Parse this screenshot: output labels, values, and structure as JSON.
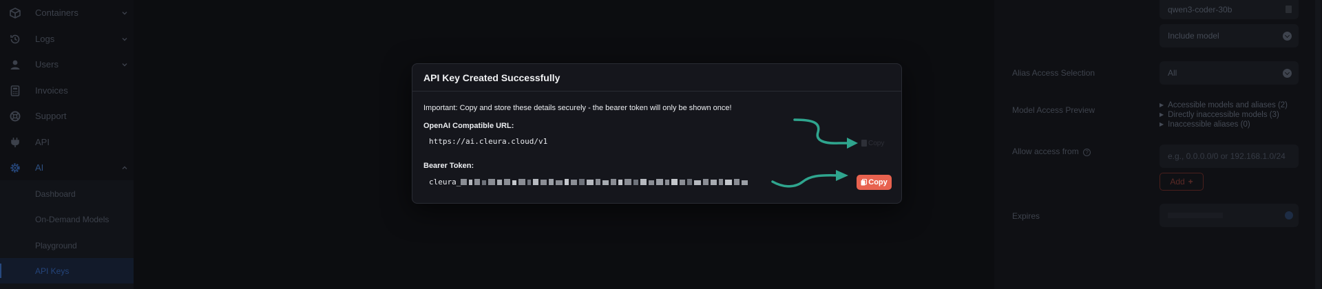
{
  "sidebar": {
    "items": [
      {
        "label": "Containers",
        "icon": "box-icon"
      },
      {
        "label": "Logs",
        "icon": "history-icon"
      },
      {
        "label": "Users",
        "icon": "user-icon"
      },
      {
        "label": "Invoices",
        "icon": "calculator-icon"
      },
      {
        "label": "Support",
        "icon": "lifebuoy-icon"
      },
      {
        "label": "API",
        "icon": "plug-icon"
      },
      {
        "label": "AI",
        "icon": "gear-icon"
      }
    ],
    "ai_subitems": [
      "Dashboard",
      "On-Demand Models",
      "Playground",
      "API Keys"
    ]
  },
  "modal": {
    "title": "API Key Created Successfully",
    "important": "Important: Copy and store these details securely - the bearer token will only be shown once!",
    "url_label": "OpenAI Compatible URL:",
    "url_value": "https://ai.cleura.cloud/v1",
    "token_label": "Bearer Token:",
    "token_prefix": "cleura_",
    "copy_label": "Copy"
  },
  "right_panel": {
    "model_value": "qwen3-coder-30b",
    "include_model": "Include model",
    "alias_label": "Alias Access Selection",
    "alias_value": "All",
    "preview_label": "Model Access Preview",
    "preview_items": [
      "Accessible models and aliases (2)",
      "Directly inaccessible models (3)",
      "Inaccessible aliases (0)"
    ],
    "allow_label": "Allow access from",
    "allow_placeholder": "e.g., 0.0.0.0/0 or 192.168.1.0/24",
    "add_label": "Add",
    "expires_label": "Expires"
  },
  "colors": {
    "accent": "#e8624f",
    "arrow": "#2fa58e",
    "active_nav": "#27497f"
  }
}
